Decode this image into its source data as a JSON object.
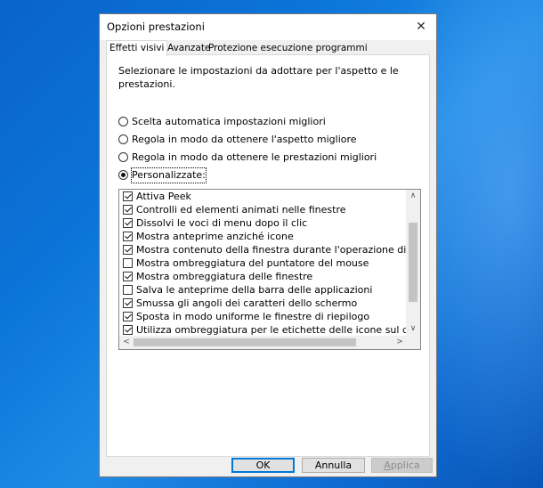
{
  "window": {
    "title": "Opzioni prestazioni",
    "close_glyph": "✕"
  },
  "tabs": [
    {
      "label": "Effetti visivi",
      "active": true
    },
    {
      "label": "Avanzate",
      "active": false
    },
    {
      "label": "Protezione esecuzione programmi",
      "active": false
    }
  ],
  "description": "Selezionare le impostazioni da adottare per l'aspetto e le prestazioni.",
  "radios": [
    {
      "label": "Scelta automatica impostazioni migliori",
      "selected": false
    },
    {
      "label": "Regola in modo da ottenere l'aspetto migliore",
      "selected": false
    },
    {
      "label": "Regola in modo da ottenere le prestazioni migliori",
      "selected": false
    },
    {
      "label": "Personalizzate:",
      "selected": true
    }
  ],
  "options": [
    {
      "label": "Attiva Peek",
      "checked": true
    },
    {
      "label": "Controlli ed elementi animati nelle finestre",
      "checked": true
    },
    {
      "label": "Dissolvi le voci di menu dopo il clic",
      "checked": true
    },
    {
      "label": "Mostra anteprime anziché icone",
      "checked": true
    },
    {
      "label": "Mostra contenuto della finestra durante l'operazione di trasc",
      "checked": true
    },
    {
      "label": "Mostra ombreggiatura del puntatore del mouse",
      "checked": false
    },
    {
      "label": "Mostra ombreggiatura delle finestre",
      "checked": true
    },
    {
      "label": "Salva le anteprime della barra delle applicazioni",
      "checked": false
    },
    {
      "label": "Smussa gli angoli dei caratteri dello schermo",
      "checked": true
    },
    {
      "label": "Sposta in modo uniforme le finestre di riepilogo",
      "checked": true
    },
    {
      "label": "Utilizza ombreggiatura per le etichette delle icone sul deskto",
      "checked": true
    }
  ],
  "scroll_glyphs": {
    "up": "∧",
    "down": "∨",
    "left": "<",
    "right": ">"
  },
  "buttons": {
    "ok": "OK",
    "cancel": "Annulla",
    "apply_first": "A",
    "apply_rest": "pplica"
  },
  "icons": {
    "close": "close-icon",
    "radio": "radio-button",
    "checkbox": "checkbox"
  }
}
